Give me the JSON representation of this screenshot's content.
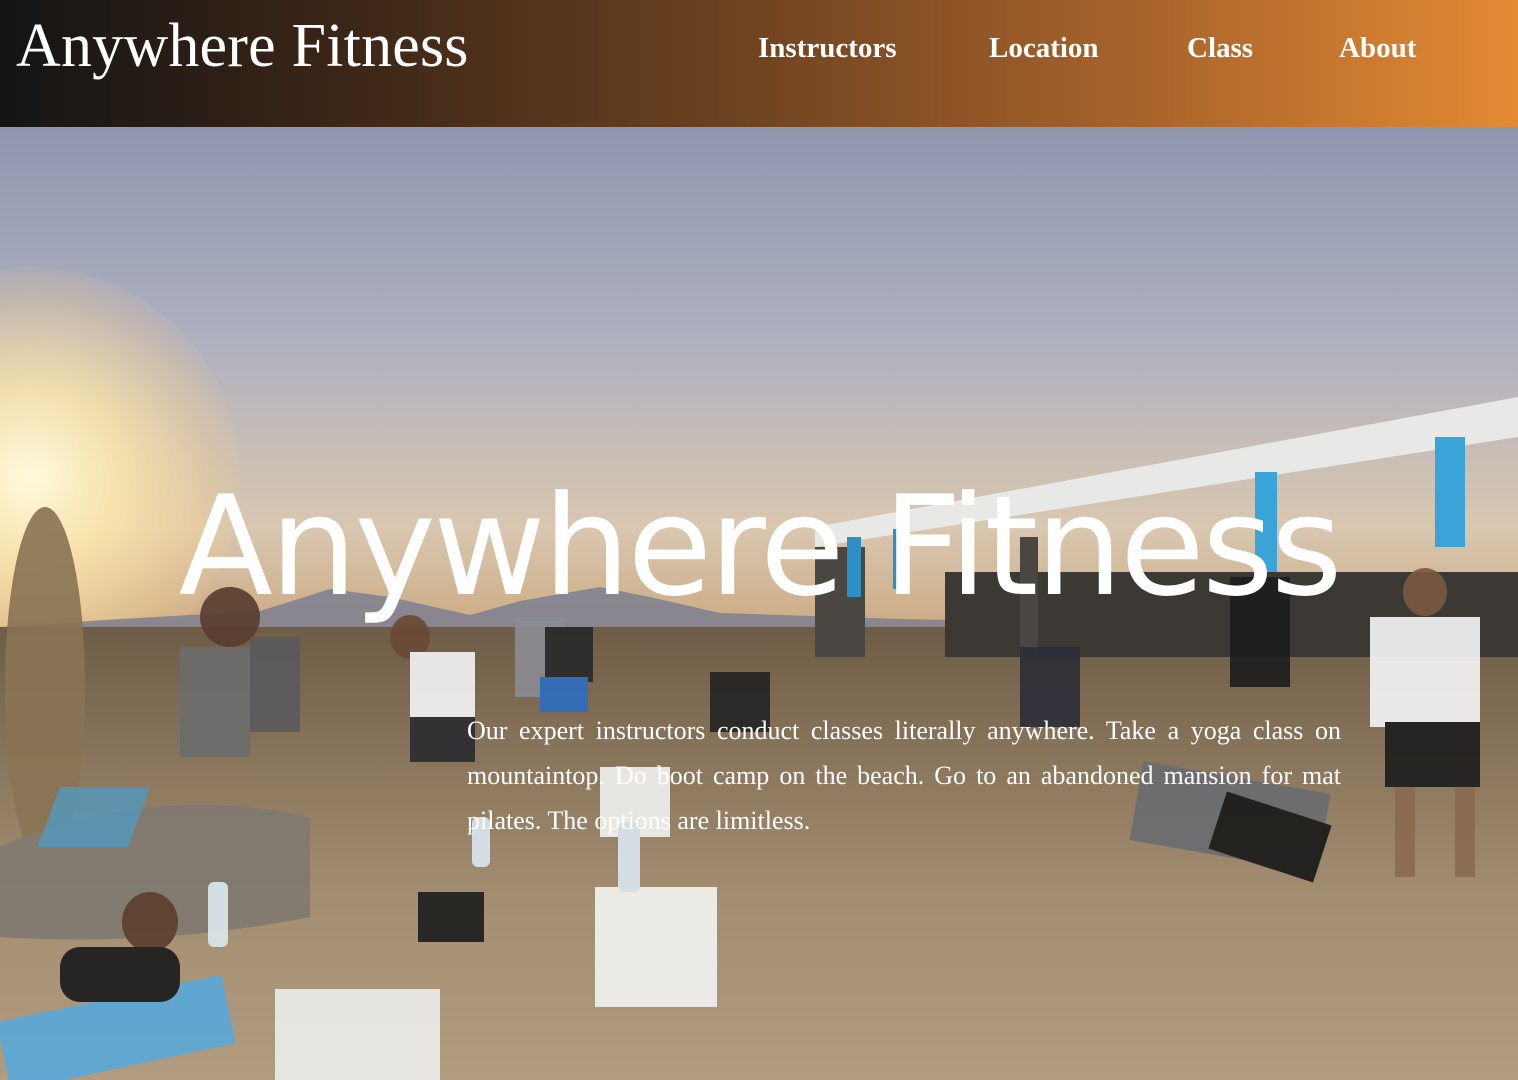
{
  "header": {
    "logo": "Anywhere Fitness",
    "nav": [
      "Instructors",
      "Location",
      "Class",
      "About"
    ]
  },
  "hero": {
    "title": "Anywhere Fitness",
    "description": "Our expert instructors conduct classes literally anywhere. Take a yoga class on mountaintop. Do boot camp on the beach. Go to an abandoned mansion for mat pilates. The options are limitless.",
    "background_image": "outdoor-group-fitness-class-photo"
  },
  "colors": {
    "header_gradient_start": "#141414",
    "header_gradient_end": "#e48a34",
    "text": "#ffffff"
  }
}
